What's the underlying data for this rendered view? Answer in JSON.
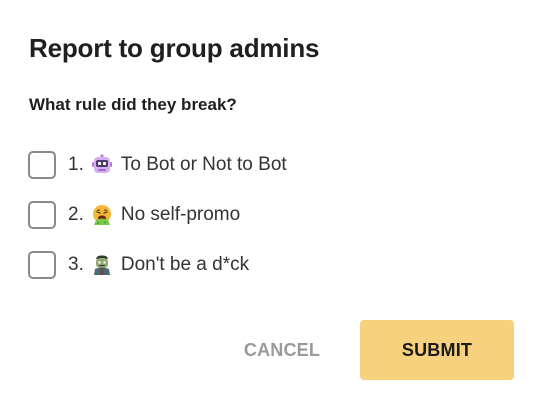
{
  "dialog": {
    "title": "Report to group admins",
    "question": "What rule did they break?"
  },
  "rules": [
    {
      "number": "1.",
      "emoji": "robot-emoji",
      "label": "To Bot or Not to Bot",
      "checked": false
    },
    {
      "number": "2.",
      "emoji": "vomiting-face-emoji",
      "label": "No self-promo",
      "checked": false
    },
    {
      "number": "3.",
      "emoji": "zombie-emoji",
      "label": "Don't be a d*ck",
      "checked": false
    }
  ],
  "actions": {
    "cancel_label": "CANCEL",
    "submit_label": "SUBMIT"
  },
  "colors": {
    "submit_bg": "#f8d17e",
    "cancel_text": "#9a9a9a",
    "checkbox_border": "#8a8a8a"
  }
}
